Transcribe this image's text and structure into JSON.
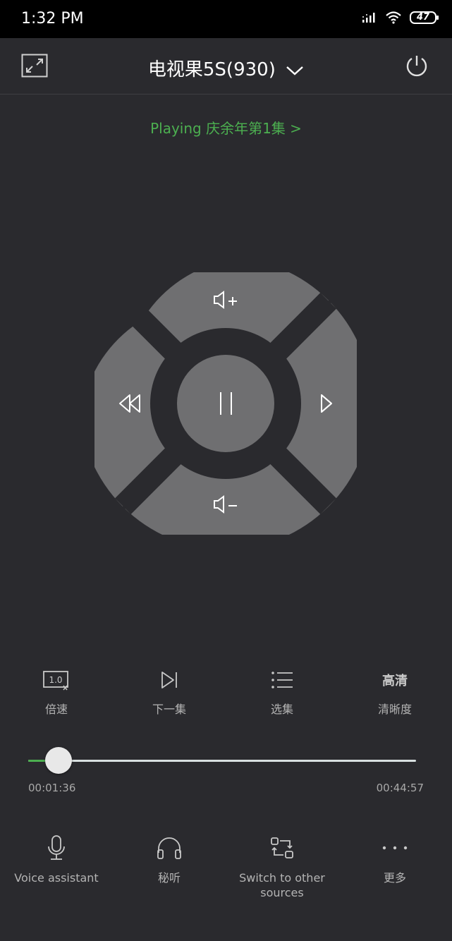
{
  "status": {
    "time": "1:32 PM",
    "battery": "47"
  },
  "header": {
    "device_name": "电视果5S(930)"
  },
  "now_playing": {
    "text": "Playing 庆余年第1集 >"
  },
  "tools": [
    {
      "label": "倍速",
      "icon": "speed-1x-icon",
      "icon_text": "1.0"
    },
    {
      "label": "下一集",
      "icon": "next-episode-icon"
    },
    {
      "label": "选集",
      "icon": "episode-list-icon"
    },
    {
      "label": "清晰度",
      "icon": "quality-icon",
      "icon_text": "高清"
    }
  ],
  "progress": {
    "current": "00:01:36",
    "total": "00:44:57",
    "fraction": 0.056
  },
  "bottom": [
    {
      "label": "Voice assistant",
      "icon": "microphone-icon"
    },
    {
      "label": "秘听",
      "icon": "headphones-icon"
    },
    {
      "label": "Switch to other sources",
      "icon": "switch-source-icon"
    },
    {
      "label": "更多",
      "icon": "more-icon"
    }
  ],
  "colors": {
    "background": "#2a2a2e",
    "accent": "#4caf50",
    "dpad": "#6f6f71"
  }
}
